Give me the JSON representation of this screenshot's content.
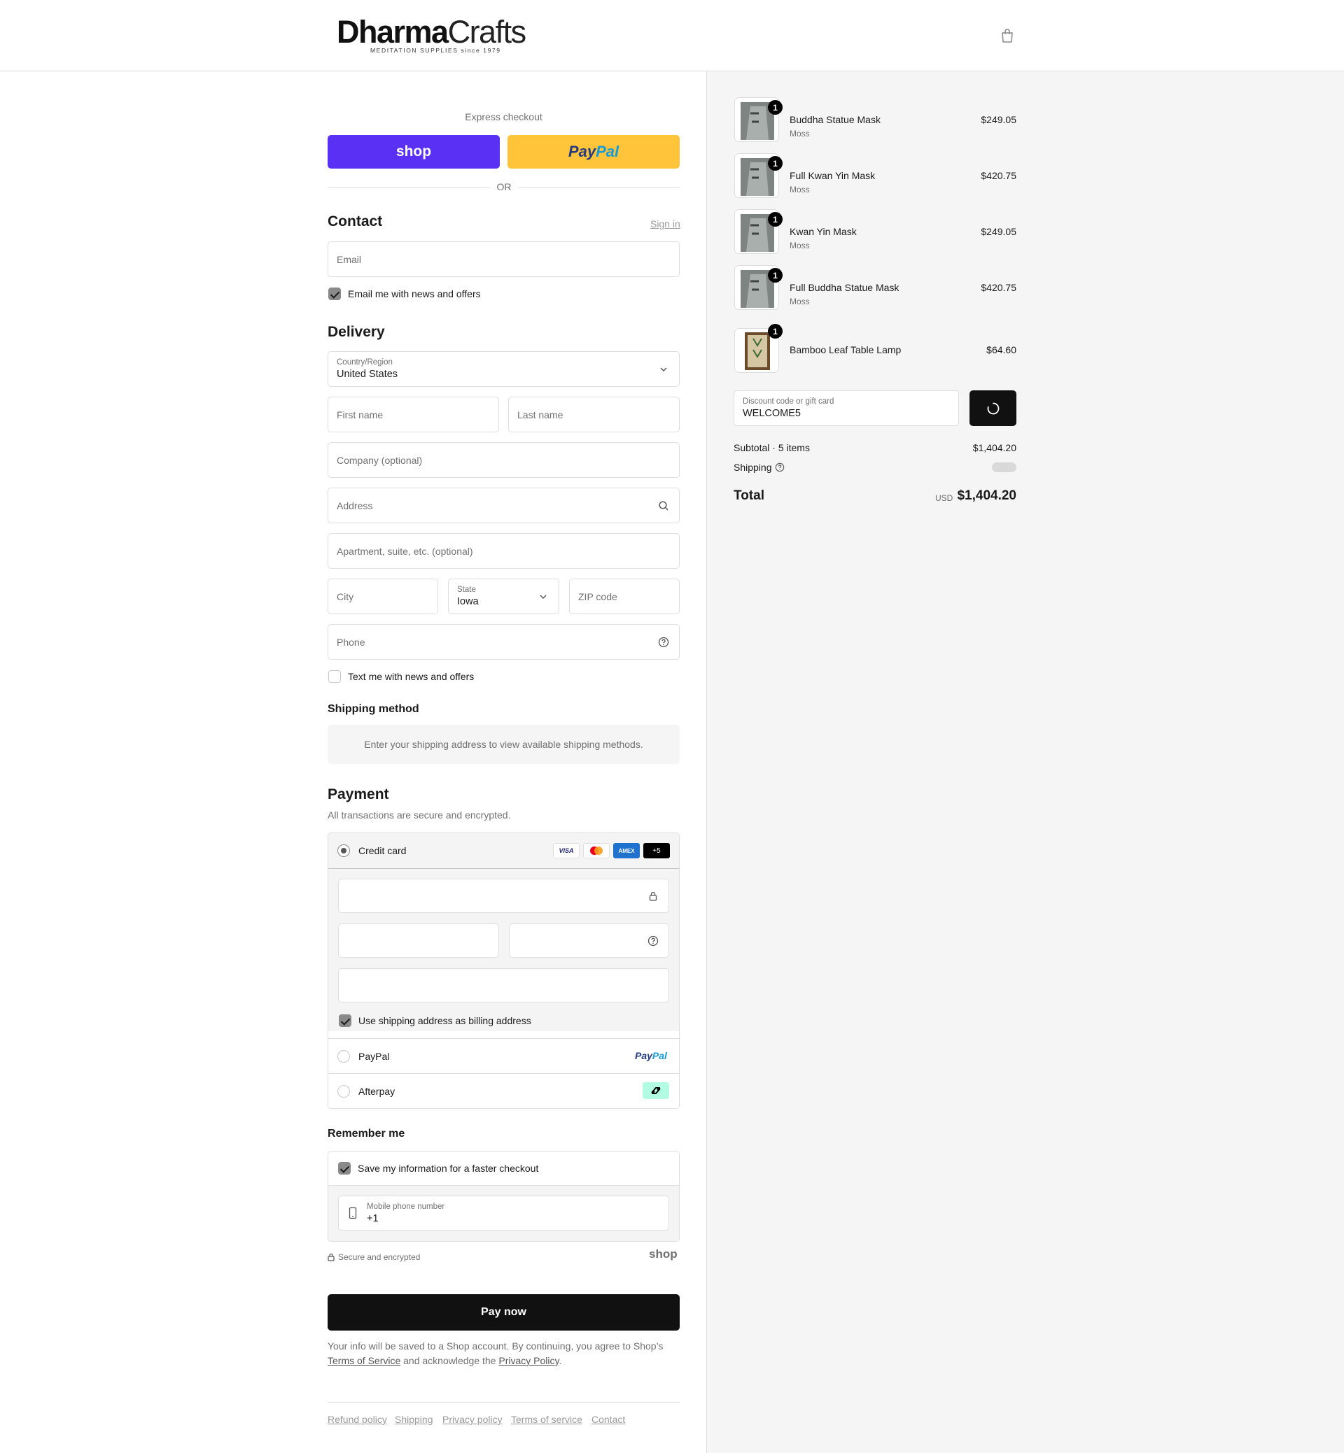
{
  "header": {
    "logo_main_a": "Dharma",
    "logo_main_b": "Crafts",
    "logo_sub": "MEDITATION SUPPLIES since 1979"
  },
  "express": {
    "title": "Express checkout",
    "shop_label": "shop",
    "paypal_a": "Pay",
    "paypal_b": "Pal",
    "or": "OR"
  },
  "contact": {
    "title": "Contact",
    "sign_in": "Sign in",
    "email_placeholder": "Email",
    "news_label": "Email me with news and offers",
    "news_checked": true
  },
  "delivery": {
    "title": "Delivery",
    "country_label": "Country/Region",
    "country_value": "United States",
    "first_name": "First name",
    "last_name": "Last name",
    "company": "Company (optional)",
    "address": "Address",
    "apartment": "Apartment, suite, etc. (optional)",
    "city": "City",
    "state_label": "State",
    "state_value": "Iowa",
    "zip": "ZIP code",
    "phone": "Phone",
    "text_label": "Text me with news and offers",
    "text_checked": false
  },
  "shipping_method": {
    "title": "Shipping method",
    "message": "Enter your shipping address to view available shipping methods."
  },
  "payment": {
    "title": "Payment",
    "subtitle": "All transactions are secure and encrypted.",
    "credit_card_label": "Credit card",
    "card_badges": [
      "VISA",
      "",
      "AMEX",
      "+5"
    ],
    "billing_label": "Use shipping address as billing address",
    "billing_checked": true,
    "paypal_label": "PayPal",
    "afterpay_label": "Afterpay"
  },
  "remember": {
    "title": "Remember me",
    "save_label": "Save my information for a faster checkout",
    "save_checked": true,
    "mobile_label": "Mobile phone number",
    "mobile_value": "+1",
    "secure_label": "Secure and encrypted",
    "shop_mark": "shop"
  },
  "pay_now": "Pay now",
  "fine_print": {
    "text_a": "Your info will be saved to a Shop account. By continuing, you agree to Shop’s ",
    "terms": "Terms of Service",
    "text_b": " and acknowledge the ",
    "privacy": "Privacy Policy",
    "text_c": "."
  },
  "footer_links": [
    "Refund policy",
    "Shipping",
    "Privacy policy",
    "Terms of service",
    "Contact"
  ],
  "cart": {
    "items": [
      {
        "name": "Buddha Statue Mask",
        "variant": "Moss",
        "price": "$249.05",
        "qty": "1"
      },
      {
        "name": "Full Kwan Yin Mask",
        "variant": "Moss",
        "price": "$420.75",
        "qty": "1"
      },
      {
        "name": "Kwan Yin Mask",
        "variant": "Moss",
        "price": "$249.05",
        "qty": "1"
      },
      {
        "name": "Full Buddha Statue Mask",
        "variant": "Moss",
        "price": "$420.75",
        "qty": "1"
      },
      {
        "name": "Bamboo Leaf Table Lamp",
        "variant": "",
        "price": "$64.60",
        "qty": "1"
      }
    ],
    "discount_label": "Discount code or gift card",
    "discount_value": "WELCOME5",
    "subtotal_label": "Subtotal · 5 items",
    "subtotal_value": "$1,404.20",
    "shipping_label": "Shipping",
    "total_label": "Total",
    "currency": "USD",
    "total_value": "$1,404.20"
  },
  "colors": {
    "shop_purple": "#5a31f4",
    "paypal_yellow": "#ffc439",
    "button_black": "#111111",
    "panel_gray": "#f5f5f5"
  }
}
